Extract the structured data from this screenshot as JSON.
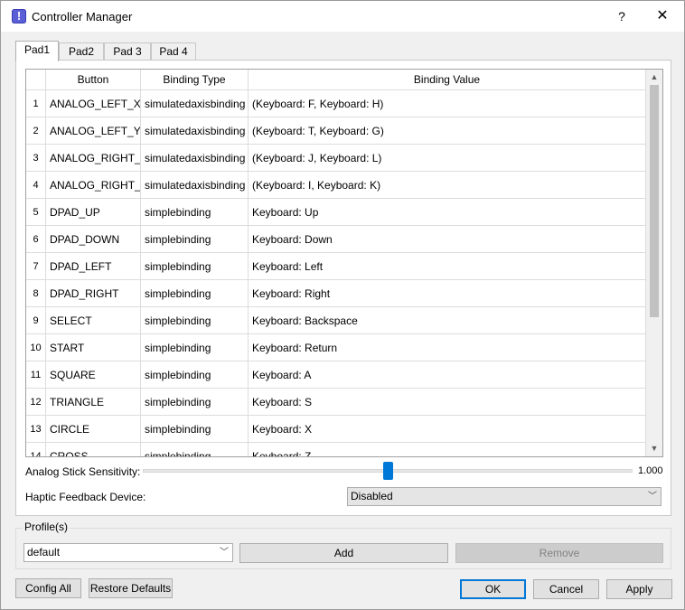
{
  "window": {
    "title": "Controller Manager",
    "help": "?",
    "close": "✕",
    "icon_glyph": "!"
  },
  "tabs": [
    {
      "label": "Pad1"
    },
    {
      "label": "Pad2"
    },
    {
      "label": "Pad 3"
    },
    {
      "label": "Pad 4"
    }
  ],
  "table": {
    "headers": {
      "button": "Button",
      "type": "Binding Type",
      "value": "Binding Value"
    },
    "rows": [
      {
        "num": "1",
        "button": "ANALOG_LEFT_X",
        "type": "simulatedaxisbinding",
        "value": "(Keyboard: F, Keyboard: H)"
      },
      {
        "num": "2",
        "button": "ANALOG_LEFT_Y",
        "type": "simulatedaxisbinding",
        "value": "(Keyboard: T, Keyboard: G)"
      },
      {
        "num": "3",
        "button": "ANALOG_RIGHT_X",
        "type": "simulatedaxisbinding",
        "value": "(Keyboard: J, Keyboard: L)"
      },
      {
        "num": "4",
        "button": "ANALOG_RIGHT_Y",
        "type": "simulatedaxisbinding",
        "value": "(Keyboard: I, Keyboard: K)"
      },
      {
        "num": "5",
        "button": "DPAD_UP",
        "type": "simplebinding",
        "value": "Keyboard: Up"
      },
      {
        "num": "6",
        "button": "DPAD_DOWN",
        "type": "simplebinding",
        "value": "Keyboard: Down"
      },
      {
        "num": "7",
        "button": "DPAD_LEFT",
        "type": "simplebinding",
        "value": "Keyboard: Left"
      },
      {
        "num": "8",
        "button": "DPAD_RIGHT",
        "type": "simplebinding",
        "value": "Keyboard: Right"
      },
      {
        "num": "9",
        "button": "SELECT",
        "type": "simplebinding",
        "value": "Keyboard: Backspace"
      },
      {
        "num": "10",
        "button": "START",
        "type": "simplebinding",
        "value": "Keyboard: Return"
      },
      {
        "num": "11",
        "button": "SQUARE",
        "type": "simplebinding",
        "value": "Keyboard: A"
      },
      {
        "num": "12",
        "button": "TRIANGLE",
        "type": "simplebinding",
        "value": "Keyboard: S"
      },
      {
        "num": "13",
        "button": "CIRCLE",
        "type": "simplebinding",
        "value": "Keyboard: X"
      },
      {
        "num": "14",
        "button": "CROSS",
        "type": "simplebinding",
        "value": "Keyboard: Z"
      }
    ],
    "scroll_up": "▲",
    "scroll_down": "▼"
  },
  "sensitivity": {
    "label": "Analog Stick Sensitivity:",
    "value_text": "1.000",
    "level": 0.5
  },
  "haptic": {
    "label": "Haptic Feedback Device:",
    "selected": "Disabled"
  },
  "profiles": {
    "label": "Profile(s)",
    "selected": "default",
    "add_label": "Add",
    "remove_label": "Remove"
  },
  "footer": {
    "config_all": "Config All",
    "restore_defaults": "Restore Defaults",
    "ok": "OK",
    "cancel": "Cancel",
    "apply": "Apply"
  },
  "colors": {
    "accent": "#0078d7",
    "disabled_bg": "#cccccc"
  },
  "icons": {
    "app": "warning-app-icon",
    "combo": "chevron-down-icon",
    "close": "close-icon",
    "help": "help-icon"
  }
}
